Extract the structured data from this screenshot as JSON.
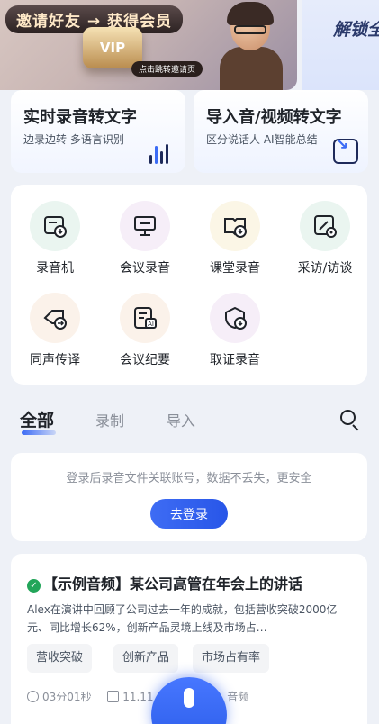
{
  "banner": {
    "invite_text": "邀请好友 → 获得会员",
    "vip_label": "VIP",
    "jump_tip": "点击跳转邀请页",
    "unlock_text": "解锁全"
  },
  "features": [
    {
      "title": "实时录音转文字",
      "subtitle": "边录边转 多语言识别",
      "icon": "waveform-icon"
    },
    {
      "title": "导入音/视频转文字",
      "subtitle": "区分说话人 AI智能总结",
      "icon": "import-icon"
    }
  ],
  "tools": [
    {
      "label": "录音机",
      "icon": "recorder-icon"
    },
    {
      "label": "会议录音",
      "icon": "meeting-record-icon"
    },
    {
      "label": "课堂录音",
      "icon": "classroom-record-icon"
    },
    {
      "label": "采访/访谈",
      "icon": "interview-icon"
    },
    {
      "label": "同声传译",
      "icon": "simultaneous-interpretation-icon"
    },
    {
      "label": "会议纪要",
      "icon": "meeting-minutes-icon"
    },
    {
      "label": "取证录音",
      "icon": "evidence-record-icon"
    }
  ],
  "tabs": [
    {
      "label": "全部",
      "active": true
    },
    {
      "label": "录制",
      "active": false
    },
    {
      "label": "导入",
      "active": false
    }
  ],
  "login": {
    "tip": "登录后录音文件关联账号，数据不丢失，更安全",
    "button": "去登录"
  },
  "sample": {
    "title": "【示例音频】某公司高管在年会上的讲话",
    "description": "Alex在演讲中回顾了公司过去一年的成就，包括营收突破2000亿元、同比增长62%，创新产品灵境上线及市场占…",
    "tags": [
      "营收突破",
      "创新产品",
      "市场占有率"
    ],
    "duration": "03分01秒",
    "date": "11.11",
    "type": "音频"
  },
  "colors": {
    "primary": "#3b6bf5",
    "verified": "#22a559"
  }
}
